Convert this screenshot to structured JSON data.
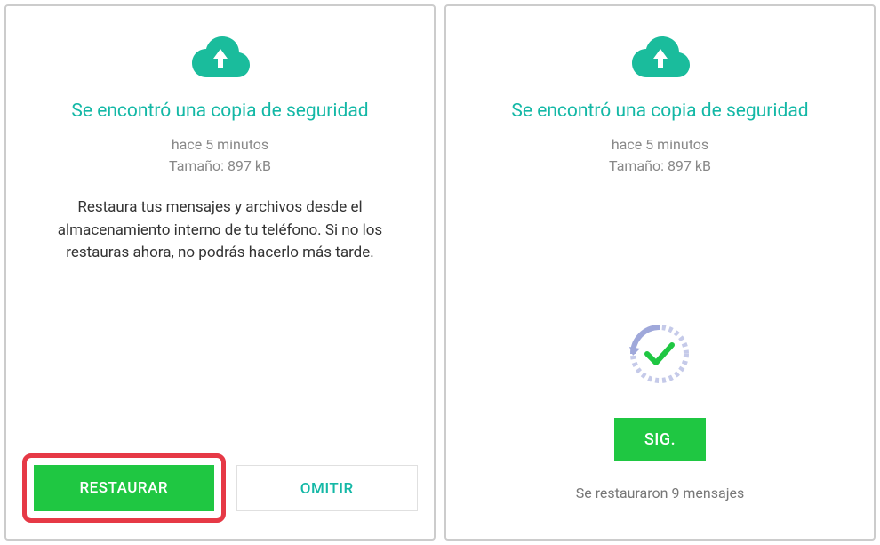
{
  "left": {
    "title": "Se encontró una copia de seguridad",
    "meta_time": "hace 5 minutos",
    "meta_size": "Tamaño: 897 kB",
    "description": "Restaura tus mensajes y archivos desde el almacenamiento interno de tu teléfono. Si no los restauras ahora, no podrás hacerlo más tarde.",
    "restore_button": "RESTAURAR",
    "skip_button": "OMITIR"
  },
  "right": {
    "title": "Se encontró una copia de seguridad",
    "meta_time": "hace 5 minutos",
    "meta_size": "Tamaño: 897 kB",
    "next_button": "SIG.",
    "status": "Se restauraron 9 mensajes"
  },
  "colors": {
    "accent": "#14b8a6",
    "primary_button": "#1fc742",
    "highlight": "#e63946"
  }
}
